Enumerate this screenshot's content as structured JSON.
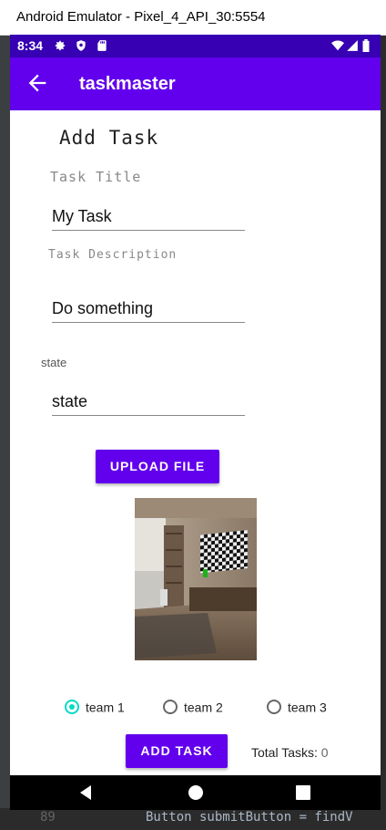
{
  "window": {
    "title": "Android Emulator - Pixel_4_API_30:5554"
  },
  "status_bar": {
    "time": "8:34",
    "icons_left": [
      "gear-icon",
      "shield-icon",
      "sd-card-icon"
    ],
    "icons_right": [
      "wifi-icon",
      "signal-icon",
      "battery-icon"
    ]
  },
  "app_bar": {
    "title": "taskmaster",
    "back_icon": "arrow-back-icon"
  },
  "form": {
    "heading": "Add Task",
    "title_label": "Task Title",
    "title_value": "My Task",
    "description_label": "Task Description",
    "description_value": "Do something",
    "state_label": "state",
    "state_value": "state",
    "upload_button": "UPLOAD FILE",
    "teams": [
      {
        "label": "team 1",
        "selected": true
      },
      {
        "label": "team 2",
        "selected": false
      },
      {
        "label": "team 3",
        "selected": false
      }
    ],
    "add_button": "ADD TASK",
    "total_tasks_label": "Total Tasks:",
    "total_tasks_count": "0"
  },
  "ide": {
    "code_snippet": "Button submitButton = findV"
  },
  "colors": {
    "primary": "#6200ee",
    "primary_dark": "#3700b3",
    "accent": "#03dac5"
  }
}
